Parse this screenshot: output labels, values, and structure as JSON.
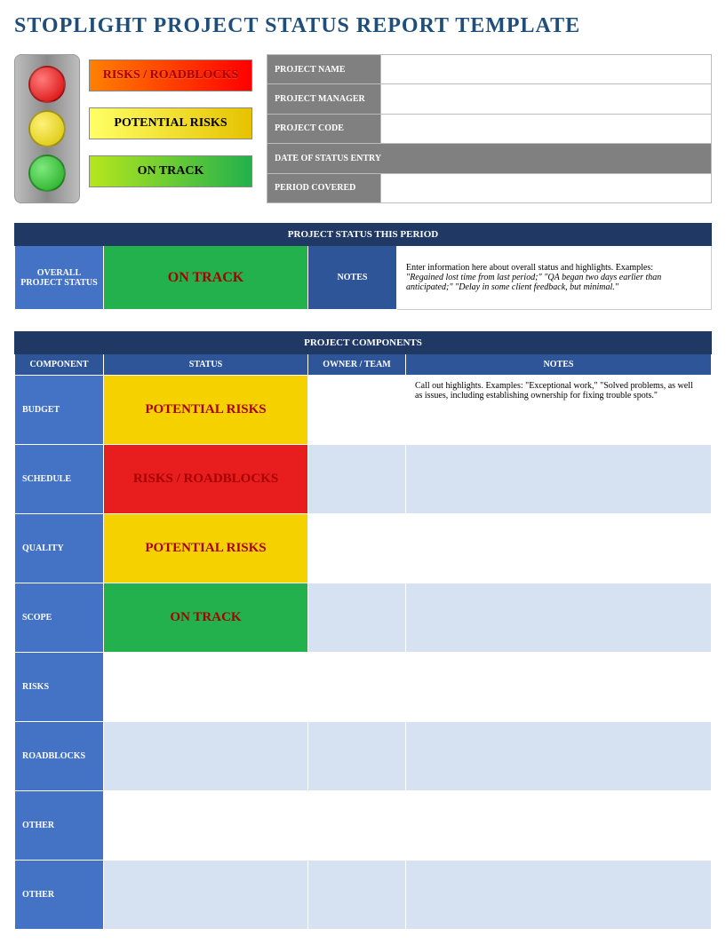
{
  "title": "STOPLIGHT PROJECT STATUS REPORT TEMPLATE",
  "legend": {
    "red": "RISKS / ROADBLOCKS",
    "yellow": "POTENTIAL RISKS",
    "green": "ON TRACK"
  },
  "meta": {
    "project_name_label": "PROJECT NAME",
    "project_manager_label": "PROJECT MANAGER",
    "project_code_label": "PROJECT CODE",
    "date_of_status_label": "DATE OF STATUS ENTRY",
    "period_covered_label": "PERIOD COVERED",
    "project_name": "",
    "project_manager": "",
    "project_code": "",
    "date_of_status": "",
    "period_covered": ""
  },
  "status_section": {
    "header": "PROJECT STATUS THIS PERIOD",
    "overall_label": "OVERALL PROJECT STATUS",
    "overall_status_text": "ON TRACK",
    "overall_status_level": "green",
    "notes_label": "NOTES",
    "notes_intro": "Enter information here about overall status and highlights. Examples:",
    "notes_example": "\"Regained lost time from last period;\" \"QA began two days earlier than anticipated;\" \"Delay in some client feedback, but minimal.\""
  },
  "components_section": {
    "header": "PROJECT COMPONENTS",
    "col_component": "COMPONENT",
    "col_status": "STATUS",
    "col_owner": "OWNER / TEAM",
    "col_notes": "NOTES",
    "rows": [
      {
        "label": "BUDGET",
        "status_text": "POTENTIAL RISKS",
        "status_level": "yellow",
        "owner": "",
        "notes": "Call out highlights. Examples: \"Exceptional work,\" \"Solved problems, as well as issues, including establishing ownership for fixing trouble spots.\""
      },
      {
        "label": "SCHEDULE",
        "status_text": "RISKS / ROADBLOCKS",
        "status_level": "red",
        "owner": "",
        "notes": ""
      },
      {
        "label": "QUALITY",
        "status_text": "POTENTIAL RISKS",
        "status_level": "yellow",
        "owner": "",
        "notes": ""
      },
      {
        "label": "SCOPE",
        "status_text": "ON TRACK",
        "status_level": "green",
        "owner": "",
        "notes": ""
      },
      {
        "label": "RISKS",
        "status_text": "",
        "status_level": "",
        "owner": "",
        "notes": ""
      },
      {
        "label": "ROADBLOCKS",
        "status_text": "",
        "status_level": "",
        "owner": "",
        "notes": ""
      },
      {
        "label": "OTHER",
        "status_text": "",
        "status_level": "",
        "owner": "",
        "notes": ""
      },
      {
        "label": "OTHER",
        "status_text": "",
        "status_level": "",
        "owner": "",
        "notes": ""
      }
    ]
  },
  "colors": {
    "dark_navy": "#1f3864",
    "mid_blue": "#2e5597",
    "light_blue": "#4472c4",
    "pale_blue": "#d6e1f1",
    "green": "#22b14c",
    "yellow": "#f5d100",
    "red": "#e81e1e"
  }
}
